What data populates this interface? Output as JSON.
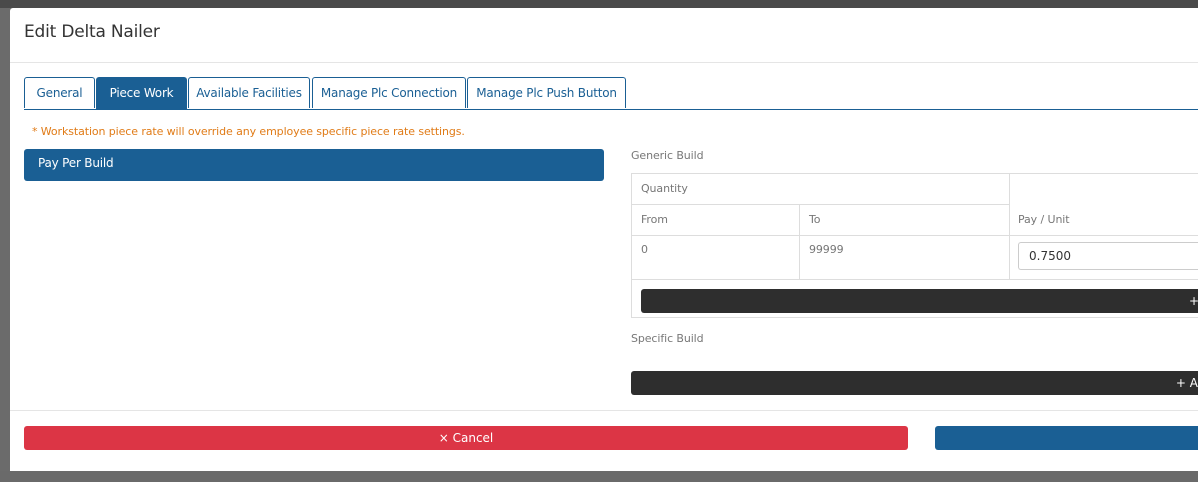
{
  "modal": {
    "title": "Edit Delta Nailer"
  },
  "tabs": [
    {
      "label": "General"
    },
    {
      "label": "Piece Work"
    },
    {
      "label": "Available Facilities"
    },
    {
      "label": "Manage Plc Connection"
    },
    {
      "label": "Manage Plc Push Button"
    }
  ],
  "active_tab": "Piece Work",
  "notice": "* Workstation piece rate will override any employee specific piece rate settings.",
  "pay_options": [
    {
      "label": "Pay Per Build"
    }
  ],
  "generic_build": {
    "label": "Generic Build",
    "group_header": "Quantity",
    "headers": {
      "from": "From",
      "to": "To",
      "pay": "Pay / Unit"
    },
    "rows": [
      {
        "from": "0",
        "to": "99999",
        "pay": "0.7500"
      }
    ],
    "add_label": "+"
  },
  "specific_build": {
    "label": "Specific Build",
    "add_label": "+ A"
  },
  "footer": {
    "cancel_label": "× Cancel",
    "save_label": ""
  },
  "colors": {
    "primary": "#1a5f94",
    "danger": "#dc3545",
    "notice": "#e07b17",
    "dark_button": "#2e2e2e"
  }
}
